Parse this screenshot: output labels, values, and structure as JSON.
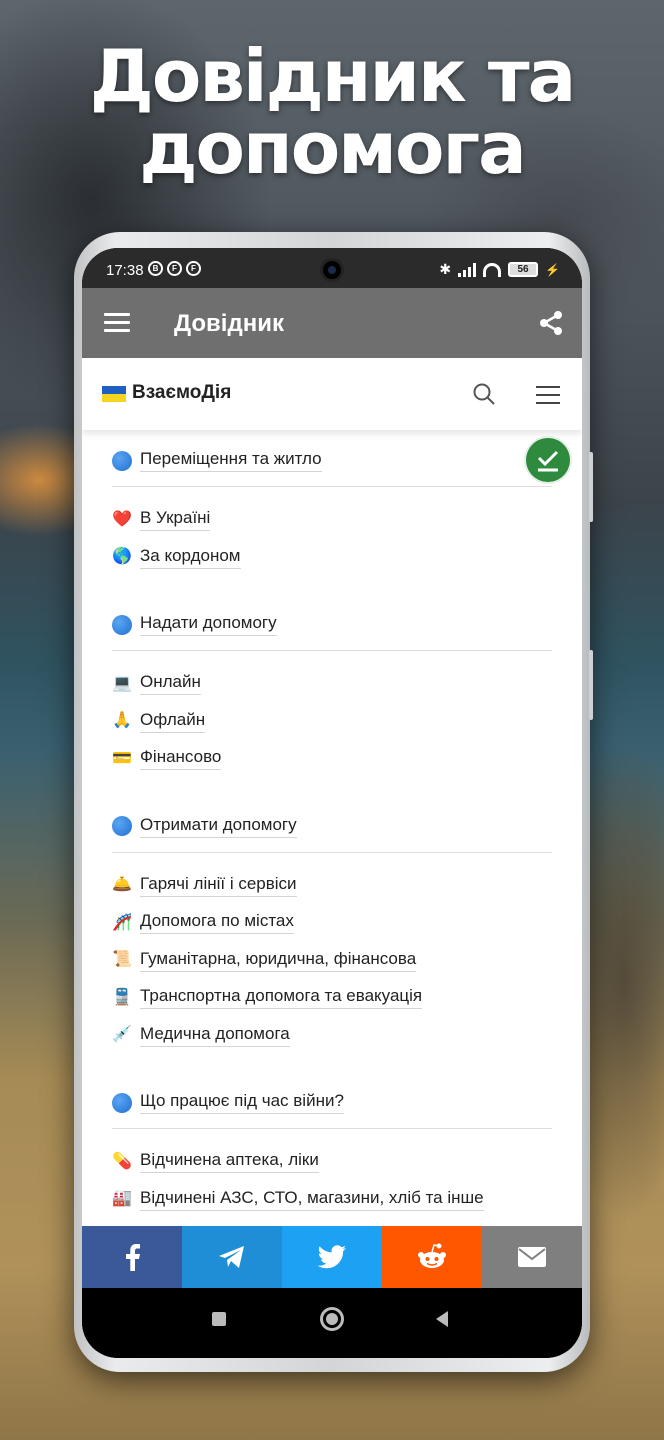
{
  "promo": {
    "headline_line1": "Довідник та",
    "headline_line2": "допомога"
  },
  "status_bar": {
    "time": "17:38",
    "battery": "56"
  },
  "app_bar": {
    "title": "Довідник"
  },
  "site_header": {
    "title": "ВзаємоДія"
  },
  "sections": [
    {
      "title": "Переміщення та житло",
      "items": [
        {
          "emoji": "❤️",
          "label": "В Україні"
        },
        {
          "emoji": "🌎",
          "label": "За кордоном"
        }
      ]
    },
    {
      "title": "Надати допомогу",
      "items": [
        {
          "emoji": "💻",
          "label": "Онлайн"
        },
        {
          "emoji": "🙏",
          "label": "Офлайн"
        },
        {
          "emoji": "💳",
          "label": "Фінансово"
        }
      ]
    },
    {
      "title": "Отримати допомогу",
      "items": [
        {
          "emoji": "🛎️",
          "label": "Гарячі лінії і сервіси"
        },
        {
          "emoji": "🎢",
          "label": "Допомога по містах"
        },
        {
          "emoji": "📜",
          "label": "Гуманітарна, юридична, фінансова"
        },
        {
          "emoji": "🚆",
          "label": "Транспортна допомога та евакуація"
        },
        {
          "emoji": "💉",
          "label": "Медична допомога"
        }
      ]
    },
    {
      "title": "Що працює під час війни?",
      "items": [
        {
          "emoji": "💊",
          "label": "Відчинена аптека, ліки"
        },
        {
          "emoji": "🏭",
          "label": "Відчинені АЗС, СТО, магазини, хліб та інше"
        }
      ]
    }
  ],
  "colors": {
    "app_bar": "#6f6f6f",
    "facebook": "#3b5998",
    "telegram": "#1f8ed6",
    "twitter": "#1da1f2",
    "reddit": "#ff5700",
    "email": "#7f7f7f",
    "check_badge": "#2e8b3e"
  }
}
